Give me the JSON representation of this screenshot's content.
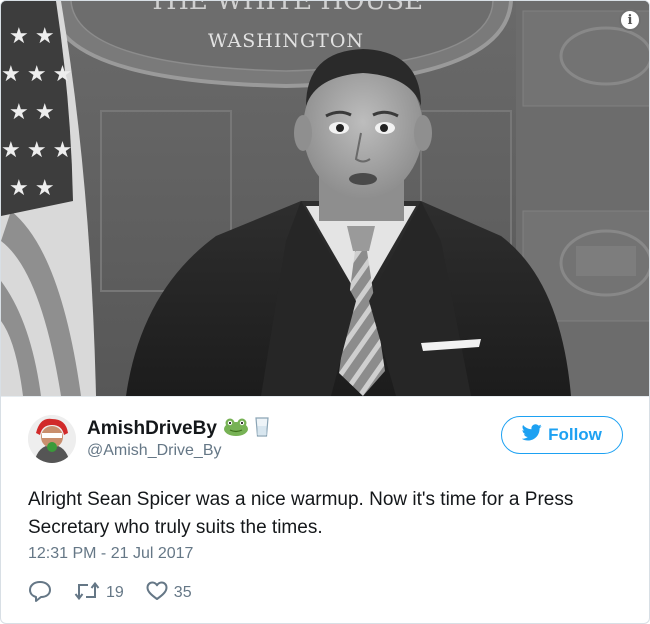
{
  "photo": {
    "seal_text": "WASHINGTON",
    "seal_top_text": "THE WHITE HOUSE",
    "info_icon": "info-icon"
  },
  "user": {
    "display_name": "AmishDriveBy",
    "handle": "@Amish_Drive_By",
    "emojis": [
      "frog-icon",
      "glass-icon"
    ]
  },
  "follow_button": {
    "label": "Follow",
    "icon": "twitter-bird-icon",
    "color": "#1da1f2"
  },
  "tweet": {
    "text_line1": "Alright Sean Spicer was a nice warmup. Now it's time for a Press",
    "text_line2": "Secretary who truly suits the times.",
    "timestamp": "12:31 PM - 21 Jul 2017"
  },
  "actions": {
    "reply_icon": "reply-icon",
    "retweet_icon": "retweet-icon",
    "retweet_count": "19",
    "like_icon": "heart-icon",
    "like_count": "35"
  }
}
